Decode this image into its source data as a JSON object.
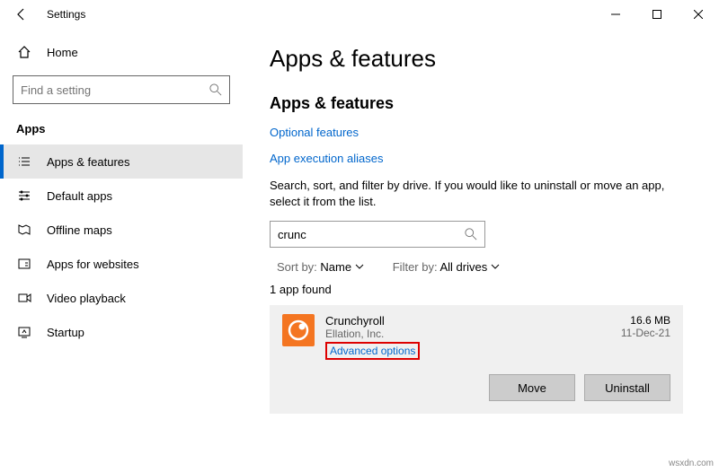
{
  "window": {
    "title": "Settings"
  },
  "sidebar": {
    "home": "Home",
    "searchPlaceholder": "Find a setting",
    "section": "Apps",
    "items": [
      {
        "label": "Apps & features"
      },
      {
        "label": "Default apps"
      },
      {
        "label": "Offline maps"
      },
      {
        "label": "Apps for websites"
      },
      {
        "label": "Video playback"
      },
      {
        "label": "Startup"
      }
    ]
  },
  "content": {
    "pageTitle": "Apps & features",
    "sectionTitle": "Apps & features",
    "links": {
      "optional": "Optional features",
      "aliases": "App execution aliases"
    },
    "helptext": "Search, sort, and filter by drive. If you would like to uninstall or move an app, select it from the list.",
    "searchValue": "crunc",
    "sort": {
      "label": "Sort by:",
      "value": "Name"
    },
    "filter": {
      "label": "Filter by:",
      "value": "All drives"
    },
    "found": "1 app found",
    "app": {
      "name": "Crunchyroll",
      "publisher": "Ellation, Inc.",
      "advanced": "Advanced options",
      "size": "16.6 MB",
      "date": "11-Dec-21",
      "moveBtn": "Move",
      "uninstallBtn": "Uninstall"
    }
  },
  "watermark": "wsxdn.com"
}
